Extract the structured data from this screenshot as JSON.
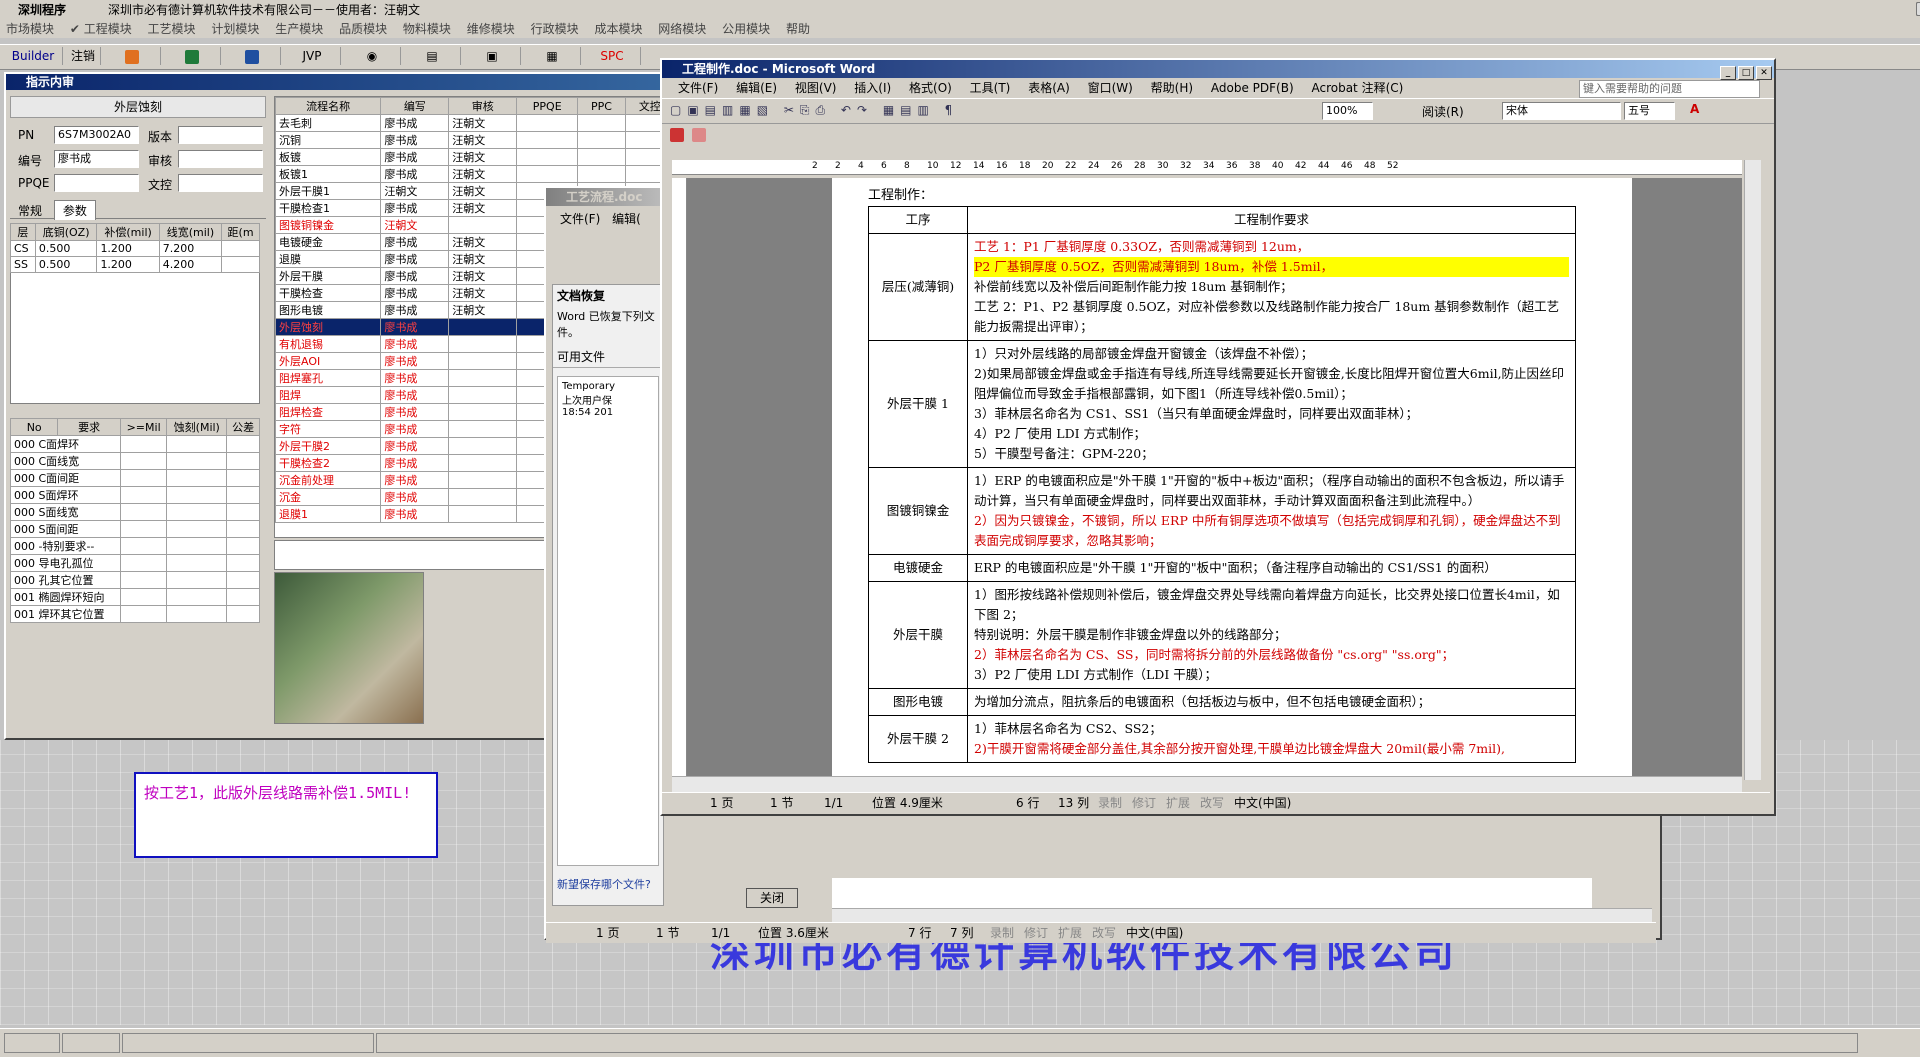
{
  "app": {
    "title": "深圳程序",
    "company": "深圳市必有德计算机软件技术有限公司－－使用者：汪朝文",
    "menu": [
      "市场模块",
      "✔ 工程模块",
      "工艺模块",
      "计划模块",
      "生产模块",
      "品质模块",
      "物料模块",
      "维修模块",
      "行政模块",
      "成本模块",
      "网络模块",
      "公用模块",
      "帮助"
    ],
    "toolbar": [
      "Builder",
      "注销",
      "JVP",
      "SPC"
    ]
  },
  "left_panel": {
    "title": "指示内审",
    "header": "外层蚀刻",
    "fields": [
      {
        "label": "PN",
        "value": "6S7M3002A0"
      },
      {
        "label": "版本",
        "value": ""
      },
      {
        "label": "编号",
        "value": "廖书成"
      },
      {
        "label": "审核",
        "value": ""
      },
      {
        "label": "PPQE",
        "value": ""
      },
      {
        "label": "文控",
        "value": ""
      }
    ],
    "tabs": [
      "常规",
      "参数"
    ],
    "param_headers": [
      "层",
      "底铜(OZ)",
      "补偿(mil)",
      "线宽(mil)",
      "距(m"
    ],
    "param_rows": [
      [
        "CS",
        "0.500",
        "1.200",
        "7.200",
        ""
      ],
      [
        "SS",
        "0.500",
        "1.200",
        "4.200",
        ""
      ]
    ],
    "req_headers": [
      "No",
      "要求",
      ">=Mil",
      "蚀刻(Mil)",
      "公差"
    ],
    "req_rows": [
      "000 C面焊环",
      "000 C面线宽",
      "000 C面间距",
      "000 S面焊环",
      "000 S面线宽",
      "000 S面间距",
      "000 -特别要求--",
      "000 导电孔孤位",
      "000 孔其它位置",
      "001 椭圆焊环短向",
      "001 焊环其它位置"
    ]
  },
  "flow_table": {
    "headers": [
      "流程名称",
      "编写",
      "审核",
      "PPQE",
      "PPC",
      "文控"
    ],
    "rows": [
      {
        "name": "去毛刺",
        "author": "廖书成",
        "review": "汪朝文",
        "red": false
      },
      {
        "name": "沉铜",
        "author": "廖书成",
        "review": "汪朝文",
        "red": false
      },
      {
        "name": "板镀",
        "author": "廖书成",
        "review": "汪朝文",
        "red": false
      },
      {
        "name": "板镀1",
        "author": "廖书成",
        "review": "汪朝文",
        "red": false
      },
      {
        "name": "外层干膜1",
        "author": "汪朝文",
        "review": "汪朝文",
        "red": false
      },
      {
        "name": "干膜检查1",
        "author": "廖书成",
        "review": "汪朝文",
        "red": false
      },
      {
        "name": "图镀铜镍金",
        "author": "汪朝文",
        "review": "",
        "red": true
      },
      {
        "name": "电镀硬金",
        "author": "廖书成",
        "review": "汪朝文",
        "red": false
      },
      {
        "name": "退膜",
        "author": "廖书成",
        "review": "汪朝文",
        "red": false
      },
      {
        "name": "外层干膜",
        "author": "廖书成",
        "review": "汪朝文",
        "red": false
      },
      {
        "name": "干膜检查",
        "author": "廖书成",
        "review": "汪朝文",
        "red": false
      },
      {
        "name": "图形电镀",
        "author": "廖书成",
        "review": "汪朝文",
        "red": false
      },
      {
        "name": "外层蚀刻",
        "author": "廖书成",
        "review": "",
        "red": true,
        "selected": true
      },
      {
        "name": "有机退锡",
        "author": "廖书成",
        "review": "",
        "red": true
      },
      {
        "name": "外层AOI",
        "author": "廖书成",
        "review": "",
        "red": true
      },
      {
        "name": "阻焊塞孔",
        "author": "廖书成",
        "review": "",
        "red": true
      },
      {
        "name": "阻焊",
        "author": "廖书成",
        "review": "",
        "red": true
      },
      {
        "name": "阻焊检查",
        "author": "廖书成",
        "review": "",
        "red": true
      },
      {
        "name": "字符",
        "author": "廖书成",
        "review": "",
        "red": true
      },
      {
        "name": "外层干膜2",
        "author": "廖书成",
        "review": "",
        "red": true
      },
      {
        "name": "干膜检查2",
        "author": "廖书成",
        "review": "",
        "red": true
      },
      {
        "name": "沉金前处理",
        "author": "廖书成",
        "review": "",
        "red": true
      },
      {
        "name": "沉金",
        "author": "廖书成",
        "review": "",
        "red": true
      },
      {
        "name": "退膜1",
        "author": "廖书成",
        "review": "",
        "red": true
      }
    ]
  },
  "note": {
    "text": "按工艺1，此版外层线路需补偿1.5MIL!"
  },
  "doc2": {
    "title": "工艺流程.doc",
    "menu": [
      "文件(F)",
      "编辑("
    ],
    "recovery_title": "文档恢复",
    "recovery_text": "Word 已恢复下列文件。",
    "available": "可用文件",
    "file_line1": "Temporary",
    "file_line2": "上次用户保",
    "file_line3": "18:54 201",
    "question": "新望保存哪个文件?",
    "close": "关闭",
    "status": [
      "1 页",
      "1 节",
      "1/1",
      "位置 3.6厘米",
      "7 行",
      "7 列",
      "录制",
      "修订",
      "扩展",
      "改写",
      "中文(中国)"
    ]
  },
  "doc1": {
    "title": "工程制作.doc - Microsoft Word",
    "menu": [
      "文件(F)",
      "编辑(E)",
      "视图(V)",
      "插入(I)",
      "格式(O)",
      "工具(T)",
      "表格(A)",
      "窗口(W)",
      "帮助(H)",
      "Adobe PDF(B)",
      "Acrobat 注释(C)"
    ],
    "help_placeholder": "键入需要帮助的问题",
    "zoom": "100%",
    "read": "阅读(R)",
    "font": "宋体",
    "size": "五号",
    "ruler": [
      "2",
      "2",
      "4",
      "6",
      "8",
      "10",
      "12",
      "14",
      "16",
      "18",
      "20",
      "22",
      "24",
      "26",
      "28",
      "30",
      "32",
      "34",
      "36",
      "38",
      "40",
      "42",
      "44",
      "46",
      "48",
      "52"
    ],
    "heading": "工程制作：",
    "col1_header": "工序",
    "col2_header": "工程制作要求",
    "rows": [
      {
        "step": "层压(减薄铜)",
        "lines": [
          {
            "t": "工艺 1：P1 厂基铜厚度 0.33OZ，否则需减薄铜到 12um，",
            "c": "red"
          },
          {
            "t": "P2 厂基铜厚度 0.5OZ，否则需减薄铜到 18um，补偿 1.5mil，",
            "c": "red-hl"
          },
          {
            "t": "补偿前线宽以及补偿后间距制作能力按 18um 基铜制作；",
            "c": "black"
          },
          {
            "t": "工艺 2：P1、P2 基铜厚度 0.5OZ，对应补偿参数以及线路制作能力按合厂 18um 基铜参数制作（超工艺能力扳需提出评审）；",
            "c": "black"
          }
        ]
      },
      {
        "step": "外层干膜 1",
        "lines": [
          {
            "t": "1）只对外层线路的局部镀金焊盘开窗镀金（该焊盘不补偿）；",
            "c": "black"
          },
          {
            "t": "2)如果局部镀金焊盘或金手指连有导线,所连导线需要延长开窗镀金,长度比阻焊开窗位置大6mil,防止因丝印阻焊偏位而导致金手指根部露铜，如下图1（所连导线补偿0.5mil）；",
            "c": "black"
          },
          {
            "t": "3）菲林层名命名为 CS1、SS1（当只有单面硬金焊盘时，同样要出双面菲林）；",
            "c": "black"
          },
          {
            "t": "4）P2 厂使用 LDI 方式制作；",
            "c": "black"
          },
          {
            "t": "5）干膜型号备注：GPM-220；",
            "c": "black"
          }
        ]
      },
      {
        "step": "图镀铜镍金",
        "lines": [
          {
            "t": "1）ERP 的电镀面积应是\"外干膜 1\"开窗的\"板中+板边\"面积；（程序自动输出的面积不包含板边，所以请手动计算，当只有单面硬金焊盘时，同样要出双面菲林，手动计算双面面积备注到此流程中。）",
            "c": "black"
          },
          {
            "t": "2）因为只镀镍金，不镀铜，所以 ERP 中所有铜厚选项不做填写（包括完成铜厚和孔铜），硬金焊盘达不到表面完成铜厚要求，忽略其影响；",
            "c": "red"
          }
        ]
      },
      {
        "step": "电镀硬金",
        "lines": [
          {
            "t": "ERP 的电镀面积应是\"外干膜 1\"开窗的\"板中\"面积；（备注程序自动输出的 CS1/SS1 的面积）",
            "c": "black"
          }
        ]
      },
      {
        "step": "外层干膜",
        "lines": [
          {
            "t": "1）图形按线路补偿规则补偿后，镀金焊盘交界处导线需向着焊盘方向延长，比交界处接口位置长4mil，如下图 2；",
            "c": "black"
          },
          {
            "t": "特别说明：外层干膜是制作非镀金焊盘以外的线路部分；",
            "c": "black"
          },
          {
            "t": "2）菲林层名命名为 CS、SS，同时需将拆分前的外层线路做备份 \"cs.org\" \"ss.org\"；",
            "c": "red"
          },
          {
            "t": "3）P2 厂使用 LDI 方式制作（LDI 干膜）；",
            "c": "black"
          }
        ]
      },
      {
        "step": "图形电镀",
        "lines": [
          {
            "t": "为增加分流点，阻抗条后的电镀面积（包括板边与板中，但不包括电镀硬金面积）；",
            "c": "black"
          }
        ]
      },
      {
        "step": "外层干膜 2",
        "lines": [
          {
            "t": "1）菲林层名命名为 CS2、SS2；",
            "c": "black"
          },
          {
            "t": "2)干膜开窗需将硬金部分盖住,其余部分按开窗处理,干膜单边比镀金焊盘大 20mil(最小需 7mil),",
            "c": "red"
          }
        ]
      }
    ],
    "status": [
      "1 页",
      "1 节",
      "1/1",
      "位置 4.9厘米",
      "6 行",
      "13 列",
      "录制",
      "修订",
      "扩展",
      "改写",
      "中文(中国)"
    ]
  },
  "desktop_brand": "深圳市必有德计算机软件技术有限公司"
}
